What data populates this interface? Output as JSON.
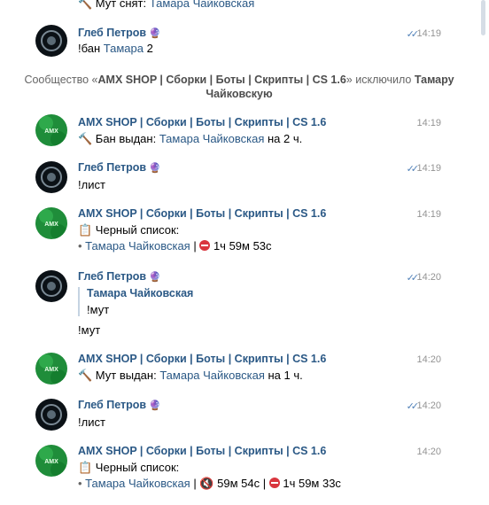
{
  "top_partial": {
    "icon": "hammer-icon",
    "prefix": "🔨 Мут снят: ",
    "user": "Тамара Чайковская"
  },
  "msg1": {
    "author": "Глеб Петров",
    "author_emoji": "🔮",
    "time": "14:19",
    "text_prefix": "!бан ",
    "text_user": "Тамара",
    "text_suffix": " 2"
  },
  "system": {
    "text_prefix": "Сообщество «",
    "community": "AMX SHOP | Сборки | Боты | Скрипты | CS 1.6",
    "text_mid": "» исключило ",
    "user": "Тамару Чайковскую"
  },
  "msg2": {
    "author": "AMX SHOP | Сборки | Боты | Скрипты | CS 1.6",
    "time": "14:19",
    "prefix": "🔨 Бан выдан: ",
    "user": "Тамара Чайковская",
    "suffix": " на 2 ч."
  },
  "msg3": {
    "author": "Глеб Петров",
    "author_emoji": "🔮",
    "time": "14:19",
    "text": "!лист"
  },
  "msg4": {
    "author": "AMX SHOP | Сборки | Боты | Скрипты | CS 1.6",
    "time": "14:19",
    "line1": "📋 Черный список:",
    "bullet": "• ",
    "user": "Тамара Чайковская",
    "sep": " | ",
    "duration": " 1ч 59м 53с"
  },
  "msg5": {
    "author": "Глеб Петров",
    "author_emoji": "🔮",
    "time": "14:20",
    "quote_author": "Тамара Чайковская",
    "quote_text": "!мут",
    "text": "!мут"
  },
  "msg6": {
    "author": "AMX SHOP | Сборки | Боты | Скрипты | CS 1.6",
    "time": "14:20",
    "prefix": "🔨 Мут выдан: ",
    "user": "Тамара Чайковская",
    "suffix": " на 1 ч."
  },
  "msg7": {
    "author": "Глеб Петров",
    "author_emoji": "🔮",
    "time": "14:20",
    "text": "!лист"
  },
  "msg8": {
    "author": "AMX SHOP | Сборки | Боты | Скрипты | CS 1.6",
    "time": "14:20",
    "line1": "📋 Черный список:",
    "bullet": "• ",
    "user": "Тамара Чайковская",
    "sep": " | ",
    "mute_icon": "🔇",
    "mute_duration": " 59м 54с",
    "sep2": " | ",
    "ban_duration": " 1ч 59м 33с"
  },
  "checks": "✓✓",
  "colors": {
    "link": "#2a5885",
    "muted": "#939393",
    "check": "#5181b8",
    "ban": "#d9363e"
  }
}
